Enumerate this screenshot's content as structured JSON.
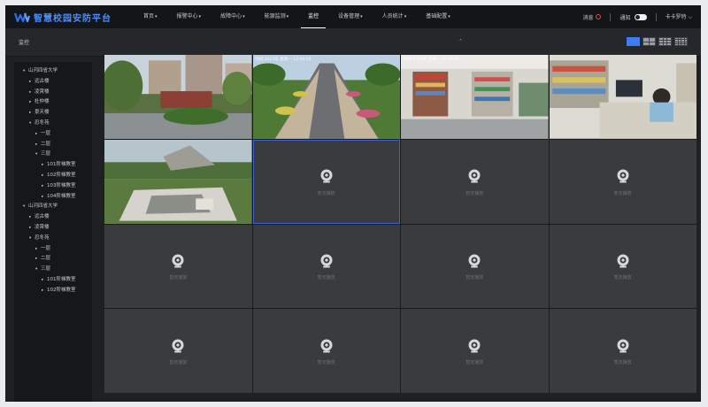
{
  "app": {
    "title": "智慧校园安防平台"
  },
  "nav": [
    {
      "label": "首页",
      "caret": "▾"
    },
    {
      "label": "报警中心",
      "caret": "▾"
    },
    {
      "label": "故障中心",
      "caret": "▾"
    },
    {
      "label": "能源监测",
      "caret": "▾"
    },
    {
      "label": "监控",
      "caret": ""
    },
    {
      "label": "设备管理",
      "caret": "▾"
    },
    {
      "label": "人员统计",
      "caret": "▾"
    },
    {
      "label": "基础配置",
      "caret": "▾"
    }
  ],
  "header": {
    "messages": "消息",
    "notify": "通知",
    "user": "卡卡罗特",
    "user_caret": "⌵"
  },
  "page": {
    "title": "监控",
    "collapse": "˄"
  },
  "tree": [
    {
      "label": "山河四省大学",
      "level": 0,
      "arrow": "▾"
    },
    {
      "label": "远古楼",
      "level": 1,
      "arrow": "▸"
    },
    {
      "label": "凌霄楼",
      "level": 1,
      "arrow": "▸"
    },
    {
      "label": "杜仲楼",
      "level": 1,
      "arrow": "▸"
    },
    {
      "label": "景天楼",
      "level": 1,
      "arrow": "▸"
    },
    {
      "label": "忍冬苑",
      "level": 1,
      "arrow": "▾"
    },
    {
      "label": "一层",
      "level": 2,
      "arrow": "▸"
    },
    {
      "label": "二层",
      "level": 2,
      "arrow": "▸"
    },
    {
      "label": "三层",
      "level": 2,
      "arrow": "▾"
    },
    {
      "label": "101阶梯教室",
      "level": 3,
      "arrow": "▸"
    },
    {
      "label": "102阶梯教室",
      "level": 3,
      "arrow": "▸"
    },
    {
      "label": "103阶梯教室",
      "level": 3,
      "arrow": "▸"
    },
    {
      "label": "104阶梯教室",
      "level": 3,
      "arrow": "▸"
    },
    {
      "label": "山河四省大学",
      "level": 0,
      "arrow": "▾"
    },
    {
      "label": "远古楼",
      "level": 1,
      "arrow": "▸"
    },
    {
      "label": "凌霄楼",
      "level": 1,
      "arrow": "▸"
    },
    {
      "label": "忍冬苑",
      "level": 1,
      "arrow": "▾"
    },
    {
      "label": "一层",
      "level": 2,
      "arrow": "▸"
    },
    {
      "label": "二层",
      "level": 2,
      "arrow": "▸"
    },
    {
      "label": "三层",
      "level": 2,
      "arrow": "▾"
    },
    {
      "label": "101阶梯教室",
      "level": 3,
      "arrow": "▸"
    },
    {
      "label": "102阶梯教室",
      "level": 3,
      "arrow": "▸"
    }
  ],
  "camera_osd": "时间 2023年 星期一 12:00:00",
  "empty_label": "暂无播放",
  "cells": [
    {
      "kind": "street"
    },
    {
      "kind": "road",
      "osd": true
    },
    {
      "kind": "shop",
      "osd": true
    },
    {
      "kind": "counter"
    },
    {
      "kind": "plaza"
    },
    {
      "kind": "empty",
      "selected": true
    },
    {
      "kind": "empty"
    },
    {
      "kind": "empty"
    },
    {
      "kind": "empty"
    },
    {
      "kind": "empty"
    },
    {
      "kind": "empty"
    },
    {
      "kind": "empty"
    },
    {
      "kind": "empty"
    },
    {
      "kind": "empty"
    },
    {
      "kind": "empty"
    },
    {
      "kind": "empty"
    }
  ],
  "colors": {
    "accent": "#3d7df0",
    "logo": "#4d8df6",
    "cell_bg": "#3a3b3d",
    "badge": "#e04a4a"
  }
}
